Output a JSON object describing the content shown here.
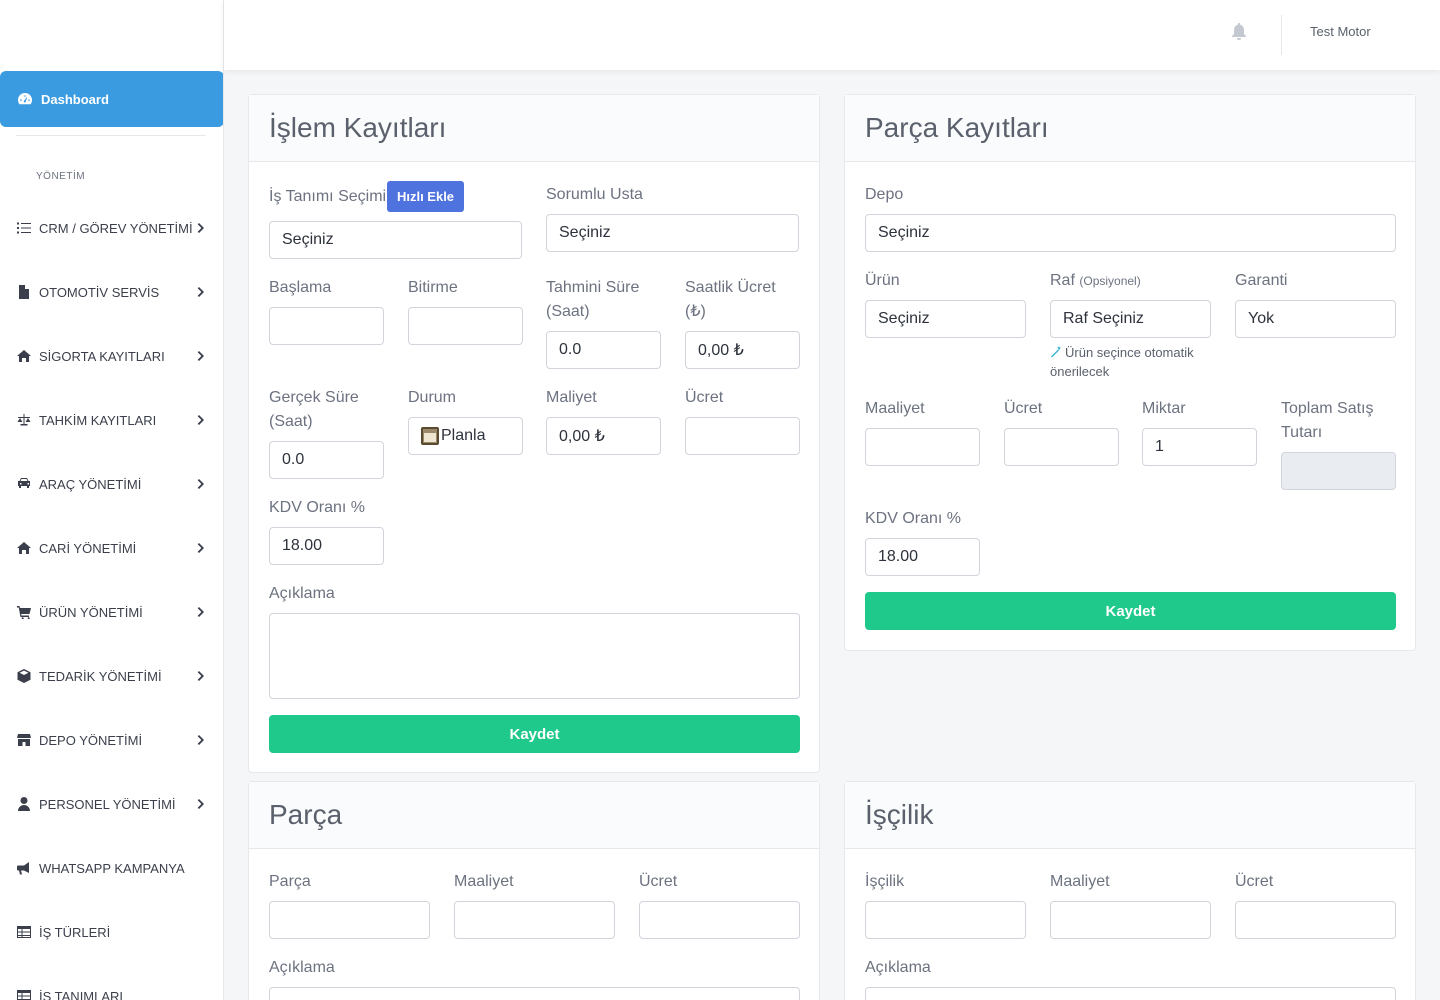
{
  "sidebar": {
    "dashboard_label": "Dashboard",
    "section_label": "YÖNETİM",
    "items": [
      {
        "label": "CRM / GÖREV YÖNETİMİ",
        "icon": "tasks-icon"
      },
      {
        "label": "OTOMOTİV SERVİS",
        "icon": "file-icon"
      },
      {
        "label": "SİGORTA KAYITLARI",
        "icon": "home-icon"
      },
      {
        "label": "TAHKİM KAYITLARI",
        "icon": "balance-scale-icon"
      },
      {
        "label": "ARAÇ YÖNETİMİ",
        "icon": "car-icon"
      },
      {
        "label": "CARİ YÖNETİMİ",
        "icon": "home-icon"
      },
      {
        "label": "ÜRÜN YÖNETİMİ",
        "icon": "cart-icon"
      },
      {
        "label": "TEDARİK YÖNETİMİ",
        "icon": "box-icon"
      },
      {
        "label": "DEPO YÖNETİMİ",
        "icon": "store-icon"
      },
      {
        "label": "PERSONEL YÖNETİMİ",
        "icon": "user-icon"
      },
      {
        "label": "WHATSAPP KAMPANYA",
        "icon": "megaphone-icon"
      },
      {
        "label": "İŞ TÜRLERİ",
        "icon": "table-icon"
      },
      {
        "label": "İŞ TANIMLARI",
        "icon": "table-icon"
      }
    ]
  },
  "topbar": {
    "user_name": "Test Motor",
    "bell_icon": "bell-icon"
  },
  "islem": {
    "title": "İşlem Kayıtları",
    "is_tanimi_label": "İş Tanımı Seçimi",
    "hizli_ekle": "Hızlı Ekle",
    "is_tanimi_value": "Seçiniz",
    "sorumlu_usta_label": "Sorumlu Usta",
    "sorumlu_usta_value": "Seçiniz",
    "baslama_label": "Başlama",
    "bitirme_label": "Bitirme",
    "tahmini_sure_label": "Tahmini Süre (Saat)",
    "tahmini_sure_value": "0.0",
    "saatlik_ucret_label": "Saatlik Ücret (₺)",
    "saatlik_ucret_value": "0,00 ₺",
    "gercek_sure_label": "Gerçek Süre (Saat)",
    "gercek_sure_value": "0.0",
    "durum_label": "Durum",
    "durum_value": "Planla",
    "maliyet_label": "Maliyet",
    "maliyet_value": "0,00 ₺",
    "ucret_label": "Ücret",
    "kdv_label": "KDV Oranı %",
    "kdv_value": "18.00",
    "aciklama_label": "Açıklama",
    "save": "Kaydet"
  },
  "parca_kayit": {
    "title": "Parça Kayıtları",
    "depo_label": "Depo",
    "depo_value": "Seçiniz",
    "urun_label": "Ürün",
    "urun_value": "Seçiniz",
    "raf_label": "Raf",
    "raf_optional": "(Opsiyonel)",
    "raf_value": "Raf Seçiniz",
    "raf_hint": "Ürün seçince otomatik önerilecek",
    "garanti_label": "Garanti",
    "garanti_value": "Yok",
    "maaliyet_label": "Maaliyet",
    "ucret_label": "Ücret",
    "miktar_label": "Miktar",
    "miktar_value": "1",
    "toplam_label": "Toplam Satış Tutarı",
    "kdv_label": "KDV Oranı %",
    "kdv_value": "18.00",
    "save": "Kaydet"
  },
  "parca": {
    "title": "Parça",
    "parca_label": "Parça",
    "maaliyet_label": "Maaliyet",
    "ucret_label": "Ücret",
    "aciklama_label": "Açıklama"
  },
  "iscilik": {
    "title": "İşçilik",
    "iscilik_label": "İşçilik",
    "maaliyet_label": "Maaliyet",
    "ucret_label": "Ücret",
    "aciklama_label": "Açıklama"
  }
}
